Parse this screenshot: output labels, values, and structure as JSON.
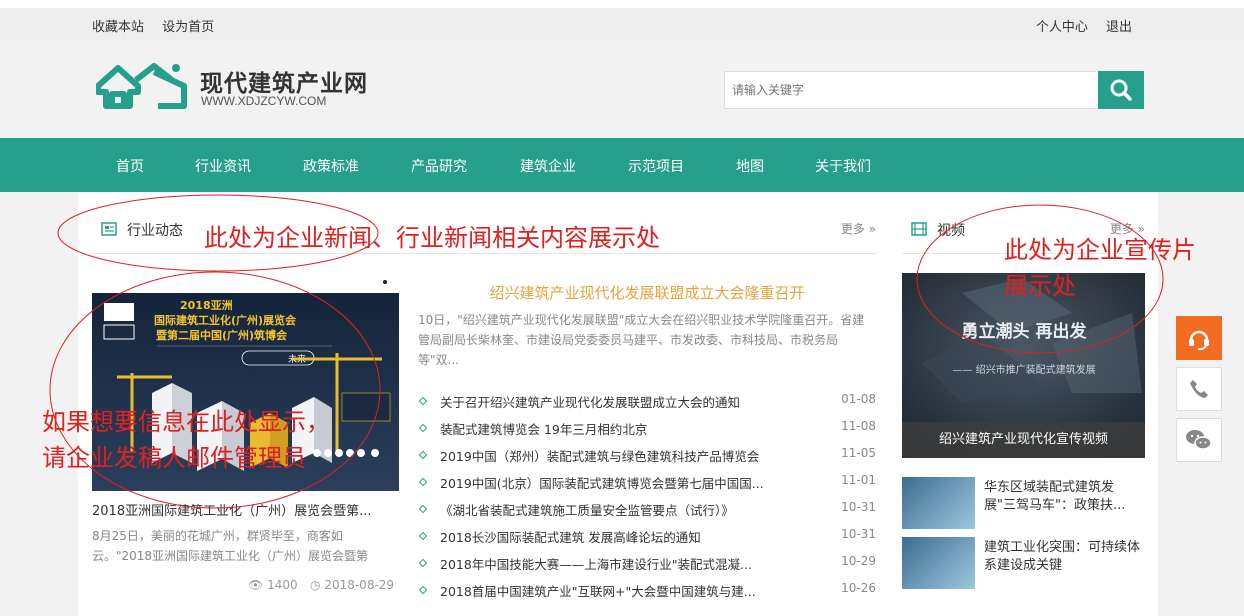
{
  "topbar": {
    "bookmark": "收藏本站",
    "set_home": "设为首页",
    "user_center": "个人中心",
    "logout": "退出"
  },
  "logo": {
    "title": "现代建筑产业网",
    "url": "WWW.XDJZCYW.COM"
  },
  "search": {
    "placeholder": "请输入关键字"
  },
  "nav": [
    "首页",
    "行业资讯",
    "政策标准",
    "产品研究",
    "建筑企业",
    "示范项目",
    "地图",
    "关于我们"
  ],
  "news_section": {
    "title": "行业动态",
    "more": "更多 »"
  },
  "video_section": {
    "title": "视频",
    "more": "更多 »"
  },
  "feature": {
    "caption": "2018亚洲国际建筑工业化（广州）展览会暨第...",
    "desc": "8月25日，美丽的花城广州，群贤毕至，商客如云。\"2018亚洲国际建筑工业化（广州）展览会暨第",
    "views": "1400",
    "date": "2018-08-29"
  },
  "headline": {
    "title": "绍兴建筑产业现代化发展联盟成立大会隆重召开",
    "desc": "10日，\"绍兴建筑产业现代化发展联盟\"成立大会在绍兴职业技术学院隆重召开。省建管局副局长柴林奎、市建设局党委委员马建平、市发改委、市科技局、市税务局等\"双..."
  },
  "news": [
    {
      "title": "关于召开绍兴建筑产业现代化发展联盟成立大会的通知",
      "date": "01-08"
    },
    {
      "title": "装配式建筑博览会 19年三月相约北京",
      "date": "11-08"
    },
    {
      "title": "2019中国（郑州）装配式建筑与绿色建筑科技产品博览会",
      "date": "11-05"
    },
    {
      "title": "2019中国(北京）国际装配式建筑博览会暨第七届中国国...",
      "date": "11-01"
    },
    {
      "title": "《湖北省装配式建筑施工质量安全监管要点（试行）》",
      "date": "10-31"
    },
    {
      "title": "2018长沙国际装配式建筑 发展高峰论坛的通知",
      "date": "10-31"
    },
    {
      "title": "2018年中国技能大赛——上海市建设行业\"装配式混凝...",
      "date": "10-29"
    },
    {
      "title": "2018首届中国建筑产业\"互联网+\"大会暨中国建筑与建...",
      "date": "10-26"
    }
  ],
  "video": {
    "caption": "绍兴建筑产业现代化宣传视频",
    "overlay_text": "勇立潮头 再出发",
    "overlay_sub": "—— 绍兴市推广装配式建筑发展"
  },
  "video_items": [
    {
      "title": "华东区域装配式建筑发展\"三驾马车\"：政策扶..."
    },
    {
      "title": "建筑工业化突围：可持续体系建设成关键"
    }
  ],
  "poster": {
    "line1": "2018亚洲",
    "line2": "国际建筑工业化(广州)展览会",
    "line3": "暨第二届中国(广州)筑博会",
    "tag": "未来"
  },
  "annotations": {
    "news_note": "此处为企业新闻、行业新闻相关内容展示处",
    "video_note_1": "此处为企业宣传片",
    "video_note_2": "展示处",
    "feature_note_1": "如果想要信息在此处显示，",
    "feature_note_2": "请企业发稿人邮件管理员"
  },
  "colors": {
    "brand": "#27a08b",
    "headline": "#e8a33c",
    "annotation": "#e02020",
    "service": "#f26c21"
  }
}
